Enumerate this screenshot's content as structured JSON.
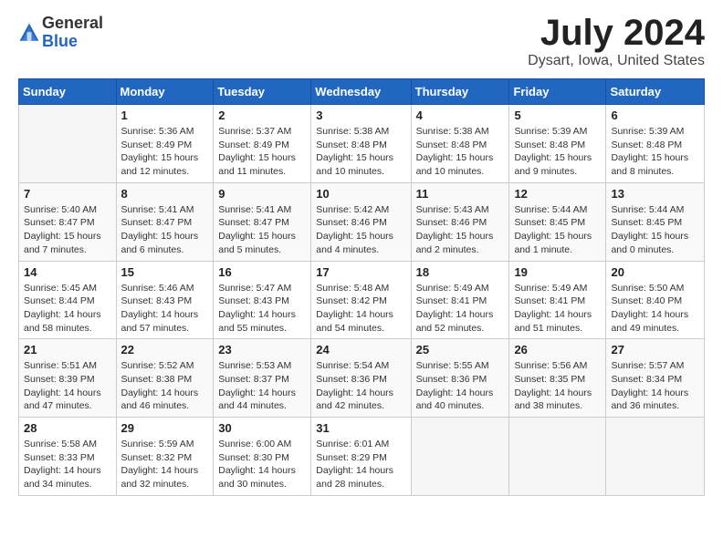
{
  "header": {
    "logo": {
      "general": "General",
      "blue": "Blue"
    },
    "title": "July 2024",
    "location": "Dysart, Iowa, United States"
  },
  "calendar": {
    "days_of_week": [
      "Sunday",
      "Monday",
      "Tuesday",
      "Wednesday",
      "Thursday",
      "Friday",
      "Saturday"
    ],
    "weeks": [
      [
        {
          "day": "",
          "info": ""
        },
        {
          "day": "1",
          "info": "Sunrise: 5:36 AM\nSunset: 8:49 PM\nDaylight: 15 hours\nand 12 minutes."
        },
        {
          "day": "2",
          "info": "Sunrise: 5:37 AM\nSunset: 8:49 PM\nDaylight: 15 hours\nand 11 minutes."
        },
        {
          "day": "3",
          "info": "Sunrise: 5:38 AM\nSunset: 8:48 PM\nDaylight: 15 hours\nand 10 minutes."
        },
        {
          "day": "4",
          "info": "Sunrise: 5:38 AM\nSunset: 8:48 PM\nDaylight: 15 hours\nand 10 minutes."
        },
        {
          "day": "5",
          "info": "Sunrise: 5:39 AM\nSunset: 8:48 PM\nDaylight: 15 hours\nand 9 minutes."
        },
        {
          "day": "6",
          "info": "Sunrise: 5:39 AM\nSunset: 8:48 PM\nDaylight: 15 hours\nand 8 minutes."
        }
      ],
      [
        {
          "day": "7",
          "info": "Sunrise: 5:40 AM\nSunset: 8:47 PM\nDaylight: 15 hours\nand 7 minutes."
        },
        {
          "day": "8",
          "info": "Sunrise: 5:41 AM\nSunset: 8:47 PM\nDaylight: 15 hours\nand 6 minutes."
        },
        {
          "day": "9",
          "info": "Sunrise: 5:41 AM\nSunset: 8:47 PM\nDaylight: 15 hours\nand 5 minutes."
        },
        {
          "day": "10",
          "info": "Sunrise: 5:42 AM\nSunset: 8:46 PM\nDaylight: 15 hours\nand 4 minutes."
        },
        {
          "day": "11",
          "info": "Sunrise: 5:43 AM\nSunset: 8:46 PM\nDaylight: 15 hours\nand 2 minutes."
        },
        {
          "day": "12",
          "info": "Sunrise: 5:44 AM\nSunset: 8:45 PM\nDaylight: 15 hours\nand 1 minute."
        },
        {
          "day": "13",
          "info": "Sunrise: 5:44 AM\nSunset: 8:45 PM\nDaylight: 15 hours\nand 0 minutes."
        }
      ],
      [
        {
          "day": "14",
          "info": "Sunrise: 5:45 AM\nSunset: 8:44 PM\nDaylight: 14 hours\nand 58 minutes."
        },
        {
          "day": "15",
          "info": "Sunrise: 5:46 AM\nSunset: 8:43 PM\nDaylight: 14 hours\nand 57 minutes."
        },
        {
          "day": "16",
          "info": "Sunrise: 5:47 AM\nSunset: 8:43 PM\nDaylight: 14 hours\nand 55 minutes."
        },
        {
          "day": "17",
          "info": "Sunrise: 5:48 AM\nSunset: 8:42 PM\nDaylight: 14 hours\nand 54 minutes."
        },
        {
          "day": "18",
          "info": "Sunrise: 5:49 AM\nSunset: 8:41 PM\nDaylight: 14 hours\nand 52 minutes."
        },
        {
          "day": "19",
          "info": "Sunrise: 5:49 AM\nSunset: 8:41 PM\nDaylight: 14 hours\nand 51 minutes."
        },
        {
          "day": "20",
          "info": "Sunrise: 5:50 AM\nSunset: 8:40 PM\nDaylight: 14 hours\nand 49 minutes."
        }
      ],
      [
        {
          "day": "21",
          "info": "Sunrise: 5:51 AM\nSunset: 8:39 PM\nDaylight: 14 hours\nand 47 minutes."
        },
        {
          "day": "22",
          "info": "Sunrise: 5:52 AM\nSunset: 8:38 PM\nDaylight: 14 hours\nand 46 minutes."
        },
        {
          "day": "23",
          "info": "Sunrise: 5:53 AM\nSunset: 8:37 PM\nDaylight: 14 hours\nand 44 minutes."
        },
        {
          "day": "24",
          "info": "Sunrise: 5:54 AM\nSunset: 8:36 PM\nDaylight: 14 hours\nand 42 minutes."
        },
        {
          "day": "25",
          "info": "Sunrise: 5:55 AM\nSunset: 8:36 PM\nDaylight: 14 hours\nand 40 minutes."
        },
        {
          "day": "26",
          "info": "Sunrise: 5:56 AM\nSunset: 8:35 PM\nDaylight: 14 hours\nand 38 minutes."
        },
        {
          "day": "27",
          "info": "Sunrise: 5:57 AM\nSunset: 8:34 PM\nDaylight: 14 hours\nand 36 minutes."
        }
      ],
      [
        {
          "day": "28",
          "info": "Sunrise: 5:58 AM\nSunset: 8:33 PM\nDaylight: 14 hours\nand 34 minutes."
        },
        {
          "day": "29",
          "info": "Sunrise: 5:59 AM\nSunset: 8:32 PM\nDaylight: 14 hours\nand 32 minutes."
        },
        {
          "day": "30",
          "info": "Sunrise: 6:00 AM\nSunset: 8:30 PM\nDaylight: 14 hours\nand 30 minutes."
        },
        {
          "day": "31",
          "info": "Sunrise: 6:01 AM\nSunset: 8:29 PM\nDaylight: 14 hours\nand 28 minutes."
        },
        {
          "day": "",
          "info": ""
        },
        {
          "day": "",
          "info": ""
        },
        {
          "day": "",
          "info": ""
        }
      ]
    ]
  }
}
